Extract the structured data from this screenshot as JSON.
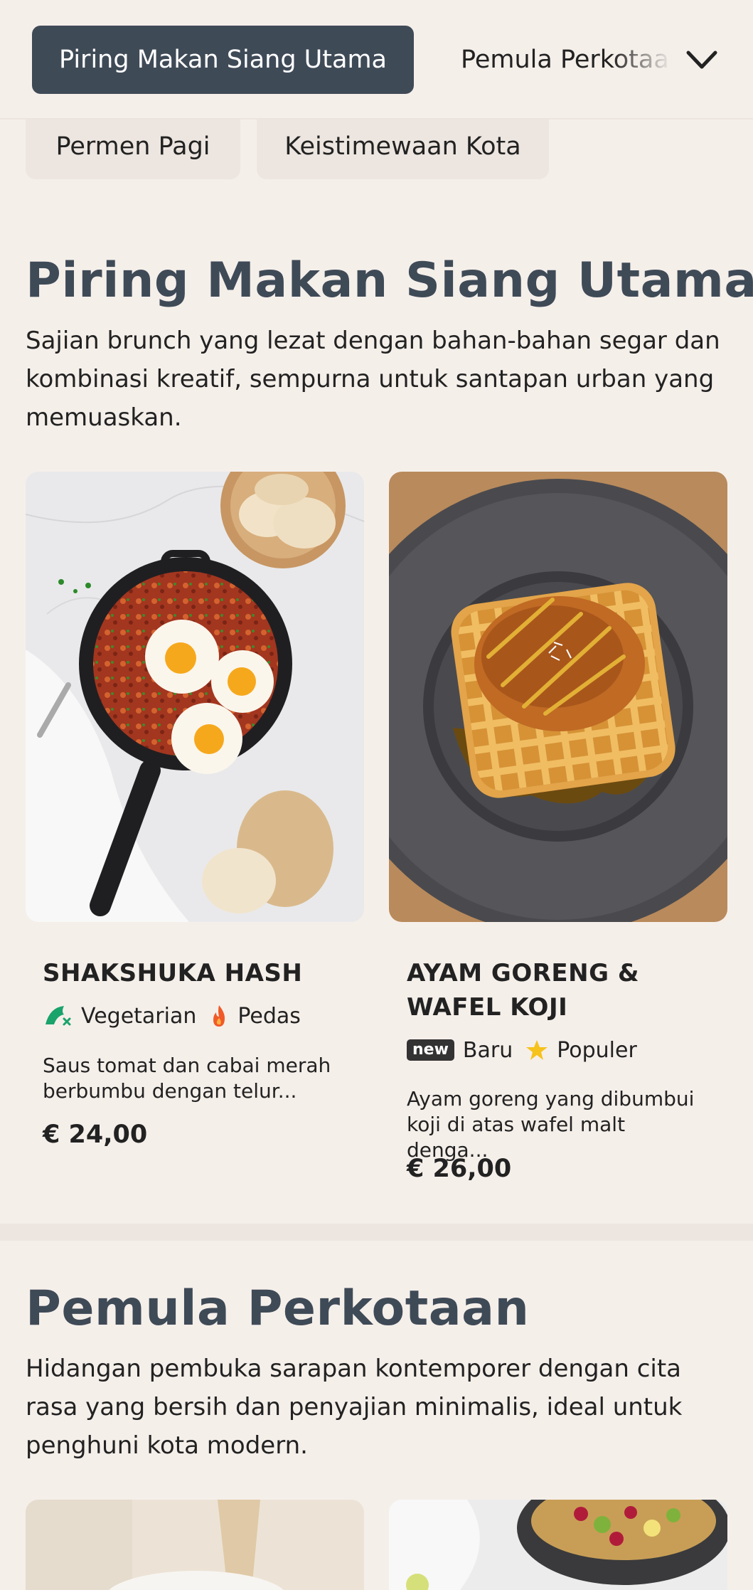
{
  "nav": {
    "active_tab": "Piring Makan Siang Utama",
    "next_tab": "Pemula Perkotaan",
    "chips": [
      "Permen Pagi",
      "Keistimewaan Kota"
    ]
  },
  "sections": [
    {
      "title": "Piring Makan Siang Utama",
      "description": "Sajian brunch yang lezat dengan bahan-bahan segar dan kombinasi kreatif, sempurna untuk santapan urban yang memuaskan.",
      "items": [
        {
          "name": "SHAKSHUKA HASH",
          "tags": [
            {
              "icon": "vegetarian-icon",
              "label": "Vegetarian"
            },
            {
              "icon": "chili-flame-icon",
              "label": "Pedas"
            }
          ],
          "description": "Saus tomat dan cabai merah berbumbu dengan telur...",
          "price": "€ 24,00"
        },
        {
          "name": "AYAM GORENG & WAFEL KOJI",
          "tags": [
            {
              "icon": "new-badge-icon",
              "badge_text": "new",
              "label": "Baru"
            },
            {
              "icon": "star-icon",
              "label": "Populer"
            }
          ],
          "description": "Ayam goreng yang dibumbui koji di atas wafel malt denga...",
          "price": "€ 26,00"
        }
      ]
    },
    {
      "title": "Pemula Perkotaan",
      "description": "Hidangan pembuka sarapan kontemporer dengan cita rasa yang bersih dan penyajian minimalis, ideal untuk penghuni kota modern."
    }
  ],
  "colors": {
    "background": "#f5efea",
    "accent": "#3f4a57",
    "veg_green": "#1aa36b",
    "flame": "#f05a28",
    "star": "#f6c21c"
  }
}
